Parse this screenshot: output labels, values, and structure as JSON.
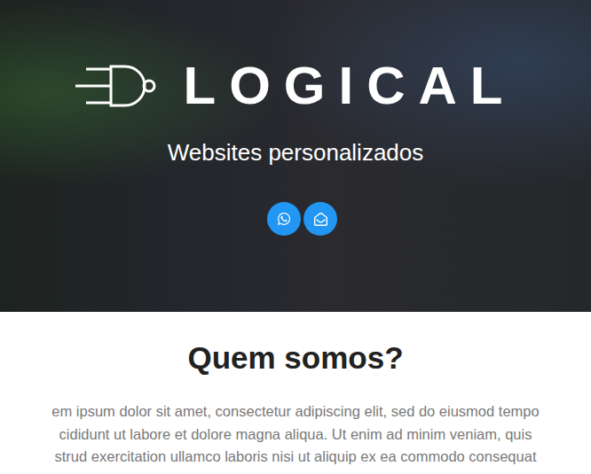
{
  "logo": {
    "text": "LOGICAL"
  },
  "hero": {
    "subtitle": "Websites personalizados"
  },
  "contact_buttons": [
    {
      "kind": "whatsapp"
    },
    {
      "kind": "email"
    }
  ],
  "about": {
    "title": "Quem somos?",
    "lines": [
      "em ipsum dolor sit amet, consectetur adipiscing elit, sed do eiusmod tempo",
      "cididunt ut labore et dolore magna aliqua. Ut enim ad minim veniam, quis",
      "strud exercitation ullamco laboris nisi ut aliquip ex ea commodo consequat"
    ]
  }
}
